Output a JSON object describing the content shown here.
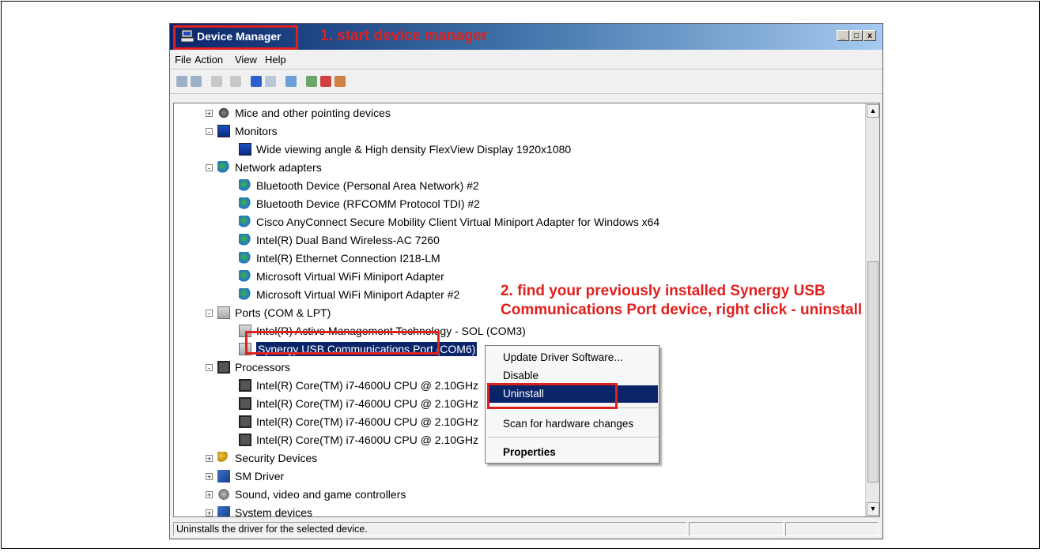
{
  "window": {
    "title": "Device Manager",
    "annotation_1": "1. start device manager",
    "controls": [
      "_",
      "□",
      "x"
    ]
  },
  "menu": [
    "File",
    "Action",
    "View",
    "Help"
  ],
  "toolbar_icons": [
    "back-icon",
    "forward-icon",
    "up-icon",
    "properties-icon",
    "help-icon",
    "view-icon",
    "scan-icon",
    "update-driver-icon",
    "uninstall-icon",
    "disable-icon"
  ],
  "tree": [
    {
      "label": "Mice and other pointing devices",
      "expander": "+",
      "icon": "mouse-icon"
    },
    {
      "label": "Monitors",
      "expander": "-",
      "icon": "monitor-icon"
    },
    {
      "label": "Wide viewing angle & High density FlexView Display 1920x1080",
      "icon": "monitor-icon"
    },
    {
      "label": "Network adapters",
      "expander": "-",
      "icon": "network-icon"
    },
    {
      "label": "Bluetooth Device (Personal Area Network) #2",
      "icon": "network-icon"
    },
    {
      "label": "Bluetooth Device (RFCOMM Protocol TDI) #2",
      "icon": "network-icon"
    },
    {
      "label": "Cisco AnyConnect Secure Mobility Client Virtual Miniport Adapter for Windows x64",
      "icon": "network-icon"
    },
    {
      "label": "Intel(R) Dual Band Wireless-AC 7260",
      "icon": "network-icon"
    },
    {
      "label": "Intel(R) Ethernet Connection I218-LM",
      "icon": "network-icon"
    },
    {
      "label": "Microsoft Virtual WiFi Miniport Adapter",
      "icon": "network-icon"
    },
    {
      "label": "Microsoft Virtual WiFi Miniport Adapter #2",
      "icon": "network-icon"
    },
    {
      "label": "Ports (COM & LPT)",
      "expander": "-",
      "icon": "port-icon"
    },
    {
      "label": "Intel(R) Active Management Technology - SOL (COM3)",
      "icon": "port-icon"
    },
    {
      "label": "Synergy USB Communications Port (COM6)",
      "icon": "port-icon",
      "selected": true
    },
    {
      "label": "Processors",
      "expander": "-",
      "icon": "cpu-icon"
    },
    {
      "label": "Intel(R) Core(TM) i7-4600U CPU @ 2.10GHz",
      "icon": "cpu-icon"
    },
    {
      "label": "Intel(R) Core(TM) i7-4600U CPU @ 2.10GHz",
      "icon": "cpu-icon"
    },
    {
      "label": "Intel(R) Core(TM) i7-4600U CPU @ 2.10GHz",
      "icon": "cpu-icon"
    },
    {
      "label": "Intel(R) Core(TM) i7-4600U CPU @ 2.10GHz",
      "icon": "cpu-icon"
    },
    {
      "label": "Security Devices",
      "expander": "+",
      "icon": "key-icon"
    },
    {
      "label": "SM Driver",
      "expander": "+",
      "icon": "system-icon"
    },
    {
      "label": "Sound, video and game controllers",
      "expander": "+",
      "icon": "sound-icon"
    },
    {
      "label": "System devices",
      "expander": "+",
      "icon": "system-icon"
    }
  ],
  "annotation_2": "2. find your previously installed Synergy USB Communications Port device, right click - uninstall",
  "context_menu": {
    "items": [
      "Update Driver Software...",
      "Disable",
      "Uninstall",
      "Scan for hardware changes",
      "Properties"
    ],
    "highlighted": "Uninstall"
  },
  "status": {
    "text": "Uninstalls the driver for the selected device."
  },
  "colors": {
    "accent_red": "#e0201e",
    "selection_blue": "#0a246a"
  }
}
